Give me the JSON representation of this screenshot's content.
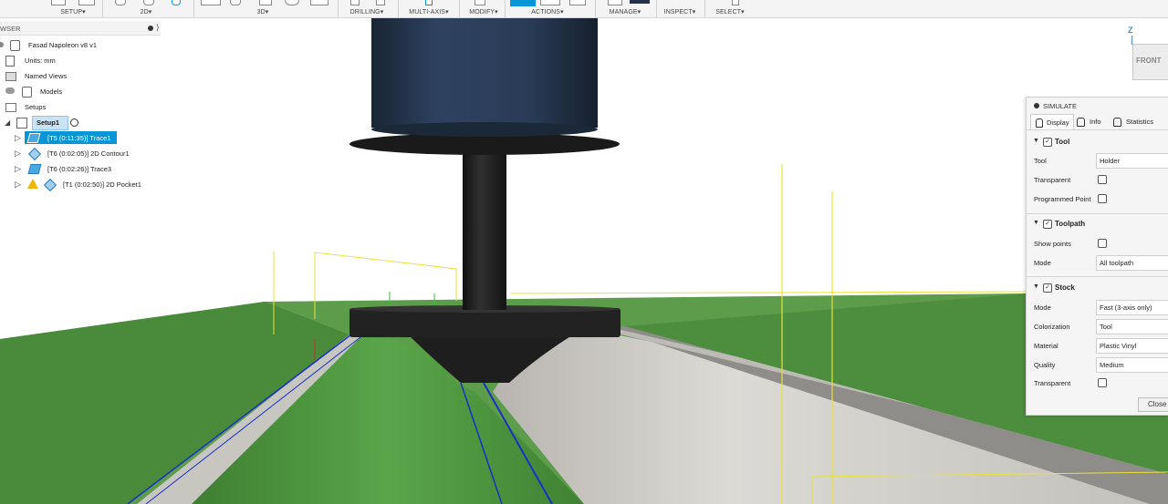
{
  "toolbar": {
    "groups": [
      "SETUP",
      "2D",
      "3D",
      "DRILLING",
      "MULTI-AXIS",
      "MODIFY",
      "ACTIONS",
      "MANAGE",
      "INSPECT",
      "SELECT"
    ],
    "dropdown_glyph": "▾"
  },
  "browser": {
    "header": "WSER",
    "items": [
      {
        "label": "Fasad Napoleon v8 v1",
        "icon": "component-icon"
      },
      {
        "label": "Units: mm",
        "icon": "document-icon"
      },
      {
        "label": "Named Views",
        "icon": "folder-icon"
      },
      {
        "label": "Models",
        "icon": "component-icon"
      },
      {
        "label": "Setups",
        "icon": "folder-icon"
      },
      {
        "label": "Setup1",
        "icon": "setup-icon"
      },
      {
        "label": "[T5 (0:11:35)] Trace1",
        "icon": "trace-icon"
      },
      {
        "label": "[T6 (0:02:05)] 2D Contour1",
        "icon": "contour-icon"
      },
      {
        "label": "[T6 (0:02:26)] Trace3",
        "icon": "trace-icon"
      },
      {
        "label": "[T1 (0:02:50)] 2D Pocket1",
        "icon": "pocket-icon"
      }
    ]
  },
  "viewcube": {
    "axis": "Z",
    "face": "FRONT"
  },
  "simulate": {
    "title": "SIMULATE",
    "tabs": [
      "Display",
      "Info",
      "Statistics"
    ],
    "tool": {
      "title": "Tool",
      "tool_label": "Tool",
      "tool_value": "Holder",
      "transparent_label": "Transparent",
      "programmed_point_label": "Programmed Point"
    },
    "toolpath": {
      "title": "Toolpath",
      "show_points_label": "Show points",
      "mode_label": "Mode",
      "mode_value": "All toolpath"
    },
    "stock": {
      "title": "Stock",
      "mode_label": "Mode",
      "mode_value": "Fast (3-axis only)",
      "colorization_label": "Colorization",
      "colorization_value": "Tool",
      "material_label": "Material",
      "material_value": "Plastic Vinyl",
      "quality_label": "Quality",
      "quality_value": "Medium",
      "transparent_label": "Transparent"
    },
    "close_label": "Close"
  },
  "colors": {
    "accent": "#0696d7",
    "stock_green": "#4f9a3f",
    "stock_grey": "#cfcdc8",
    "toolpath_yellow": "#e8e23a",
    "toolpath_blue": "#1830c8",
    "tool_body": "#23324a",
    "holder_black": "#1e1e1e"
  }
}
